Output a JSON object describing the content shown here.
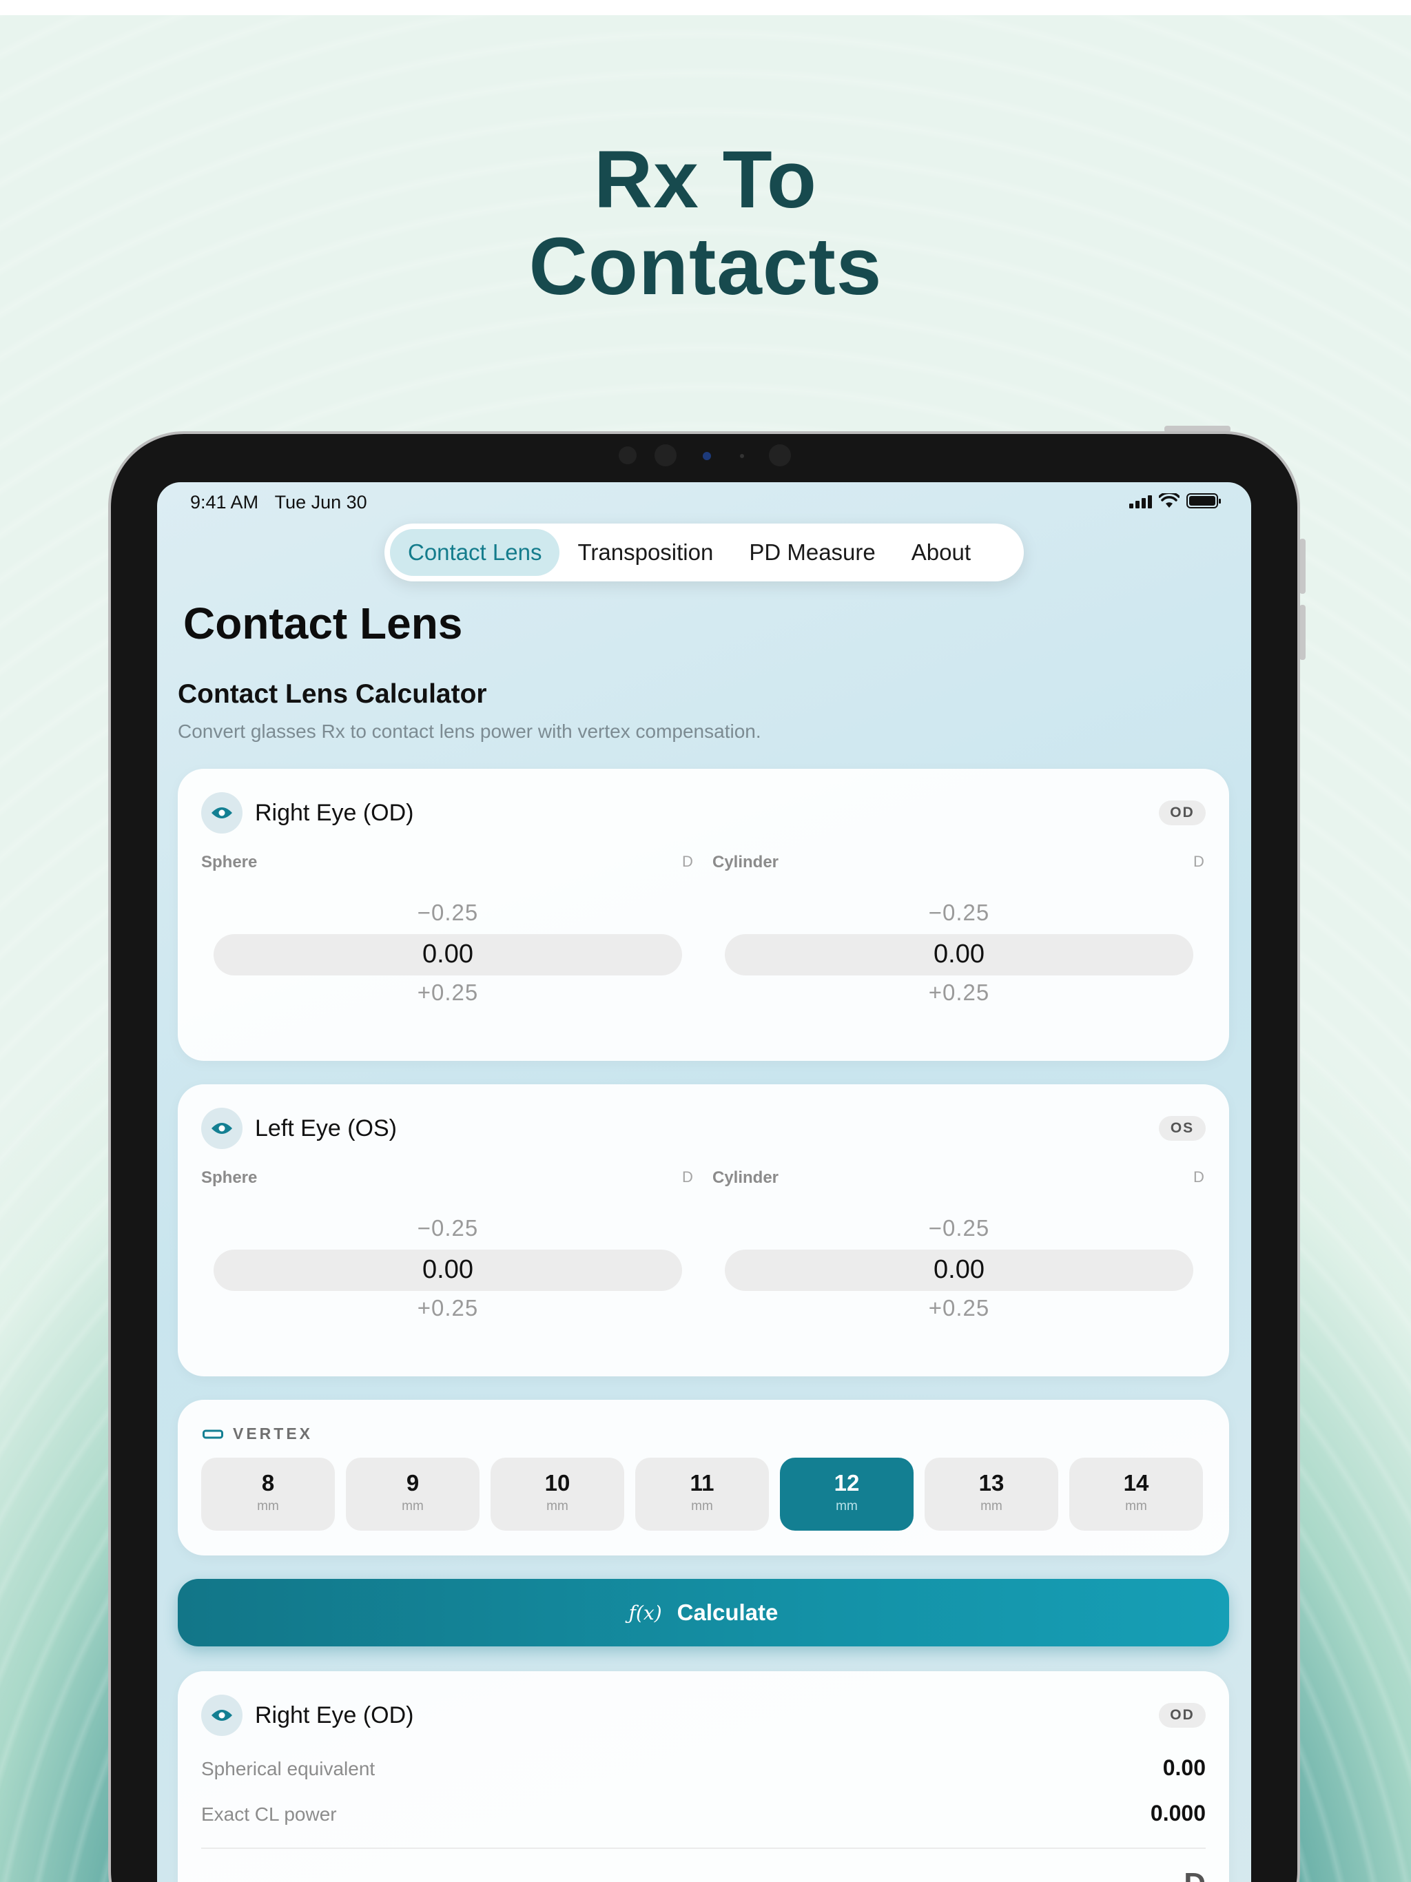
{
  "headline": {
    "line1": "Rx To",
    "line2": "Contacts"
  },
  "status_bar": {
    "time": "9:41 AM",
    "date": "Tue Jun 30"
  },
  "tabs": [
    {
      "label": "Contact Lens",
      "active": true
    },
    {
      "label": "Transposition",
      "active": false
    },
    {
      "label": "PD Measure",
      "active": false
    },
    {
      "label": "About",
      "active": false
    }
  ],
  "page": {
    "title": "Contact Lens",
    "section_title": "Contact Lens Calculator",
    "section_subtitle": "Convert glasses Rx to contact lens power with vertex compensation."
  },
  "right_eye": {
    "title": "Right Eye (OD)",
    "badge": "OD",
    "sphere": {
      "label": "Sphere",
      "unit": "D",
      "prev": "−0.25",
      "value": "0.00",
      "next": "+0.25"
    },
    "cylinder": {
      "label": "Cylinder",
      "unit": "D",
      "prev": "−0.25",
      "value": "0.00",
      "next": "+0.25"
    }
  },
  "left_eye": {
    "title": "Left Eye (OS)",
    "badge": "OS",
    "sphere": {
      "label": "Sphere",
      "unit": "D",
      "prev": "−0.25",
      "value": "0.00",
      "next": "+0.25"
    },
    "cylinder": {
      "label": "Cylinder",
      "unit": "D",
      "prev": "−0.25",
      "value": "0.00",
      "next": "+0.25"
    }
  },
  "vertex": {
    "label": "VERTEX",
    "unit": "mm",
    "options": [
      "8",
      "9",
      "10",
      "11",
      "12",
      "13",
      "14"
    ],
    "selected": "12"
  },
  "calculate": {
    "icon_text": "ƒ(x)",
    "label": "Calculate"
  },
  "result_right": {
    "title": "Right Eye (OD)",
    "badge": "OD",
    "spherical_equivalent_label": "Spherical equivalent",
    "spherical_equivalent_value": "0.00",
    "exact_cl_power_label": "Exact CL power",
    "exact_cl_power_value": "0.000",
    "partial_glyph": "D"
  },
  "colors": {
    "accent": "#137f92",
    "headline": "#174a4e",
    "tab_active_bg": "#cfe9ee"
  }
}
